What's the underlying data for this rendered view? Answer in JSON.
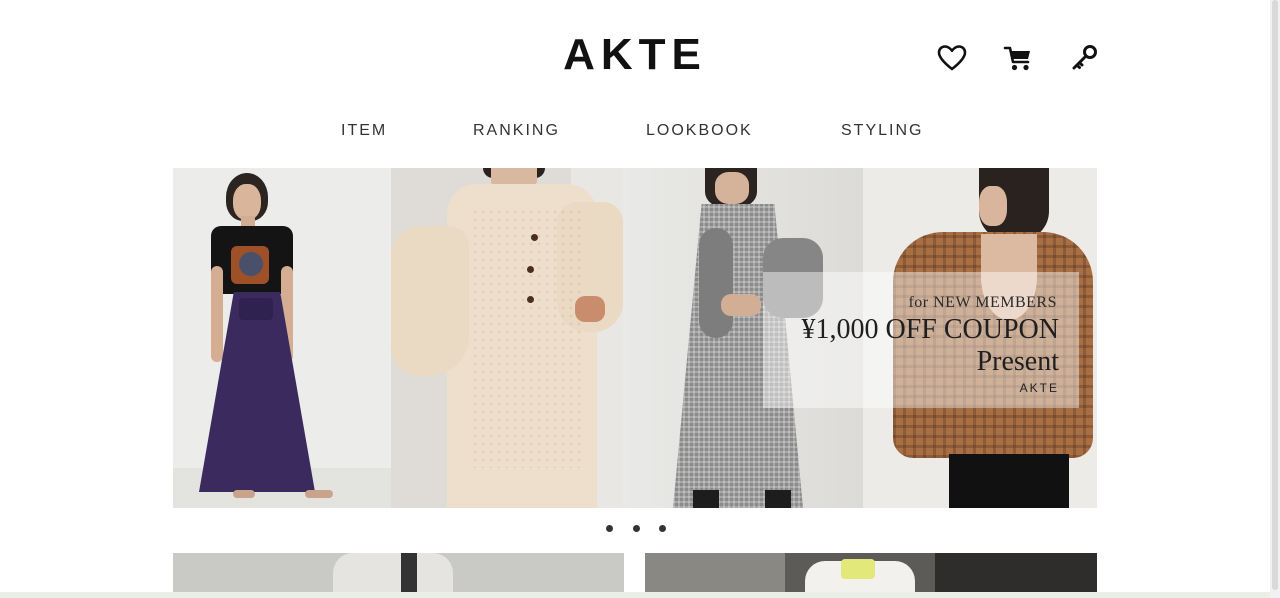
{
  "header": {
    "logo": "AKTE",
    "icons": [
      "heart-icon",
      "cart-icon",
      "key-icon"
    ]
  },
  "nav": {
    "items": [
      {
        "label": "ITEM"
      },
      {
        "label": "RANKING"
      },
      {
        "label": "LOOKBOOK"
      },
      {
        "label": "STYLING"
      }
    ]
  },
  "hero": {
    "coupon": {
      "line1": "for NEW MEMBERS",
      "line2": "¥1,000 OFF COUPON",
      "line3": "Present",
      "brand": "AKTE"
    }
  },
  "carousel": {
    "slide_count": 3,
    "active_index": 0
  },
  "colors": {
    "accent": "#111111",
    "nav_text": "#333333",
    "skirt_purple": "#3b2a5e",
    "knit_cream": "#eedfcc",
    "gingham_grey": "#8b8b8b",
    "blouse_brown": "#a86f45"
  }
}
